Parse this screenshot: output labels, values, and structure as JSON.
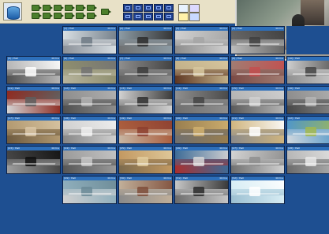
{
  "toolbar": {
    "app_icon": "database-icon",
    "camera_buttons": 6,
    "layout_buttons": 10,
    "utility_icons": [
      "camera-search-icon",
      "tag-icon",
      "folder-icon",
      "info-icon"
    ]
  },
  "preview": {
    "label": "store-camera-preview"
  },
  "colors": {
    "background": "#1e4f91",
    "toolbar": "#e8e1c7",
    "tile_header": "#2d6fba"
  },
  "tiles": [
    {
      "label": "[1] / Hall",
      "time": "00 hrs",
      "c1": "#d9e0e4",
      "c2": "#8a9098",
      "a": "#6e7a85"
    },
    {
      "label": "[2] / Hall",
      "time": "00 hrs",
      "c1": "#8d9ca6",
      "c2": "#6f7172",
      "a": "#2d2d2d"
    },
    {
      "label": "[3] / Hall",
      "time": "00 hrs",
      "c1": "#d2d2d2",
      "c2": "#8b8b8b",
      "a": "#a6a6a6"
    },
    {
      "label": "[4] / Hall",
      "time": "00 hrs",
      "c1": "#646464",
      "c2": "#bdbdbd",
      "a": "#3f3f3f"
    },
    {
      "label": "[5] / Hall",
      "time": "00 hrs",
      "c1": "#b8b8b8",
      "c2": "#505050",
      "a": "#ffffff"
    },
    {
      "label": "[6] / Hall",
      "time": "00 hrs",
      "c1": "#8e8e6e",
      "c2": "#b7b49d",
      "a": "#727272"
    },
    {
      "label": "[7] / Hall",
      "time": "00 hrs",
      "c1": "#8f8f8f",
      "c2": "#626262",
      "a": "#3c3c3c"
    },
    {
      "label": "[8] / Hall",
      "time": "00 hrs",
      "c1": "#c6b58d",
      "c2": "#5e3622",
      "a": "#d7c79f"
    },
    {
      "label": "[9] / Hall",
      "time": "00 hrs",
      "c1": "#a27d73",
      "c2": "#7a4a45",
      "a": "#c44f4f"
    },
    {
      "label": "[10] / Hall",
      "time": "00 hrs",
      "c1": "#cfcfcf",
      "c2": "#8f8f8f",
      "a": "#444444"
    },
    {
      "label": "[11] / Hall",
      "time": "00 hrs",
      "c1": "#8e2a20",
      "c2": "#d4d4d4",
      "a": "#5e5e5e"
    },
    {
      "label": "[12] / Hall",
      "time": "00 hrs",
      "c1": "#8f8f8f",
      "c2": "#4f4f4f",
      "a": "#b3b3b3"
    },
    {
      "label": "[13] / Hall",
      "time": "00 hrs",
      "c1": "#d3d3d3",
      "c2": "#6f6f6f",
      "a": "#2f2f2f"
    },
    {
      "label": "[14] / Hall",
      "time": "00 hrs",
      "c1": "#909090",
      "c2": "#6e6e6e",
      "a": "#444444"
    },
    {
      "label": "[15] / Hall",
      "time": "00 hrs",
      "c1": "#b7b7b7",
      "c2": "#5a5a5a",
      "a": "#d0d0d0"
    },
    {
      "label": "[16] / Hall",
      "time": "00 hrs",
      "c1": "#8f8f8f",
      "c2": "#474747",
      "a": "#b5b5b5"
    },
    {
      "label": "[17] / Hall",
      "time": "00 hrs",
      "c1": "#b49b72",
      "c2": "#6d5a3f",
      "a": "#d9c6a4"
    },
    {
      "label": "[18] / Hall",
      "time": "00 hrs",
      "c1": "#d2d2d2",
      "c2": "#868686",
      "a": "#f0f0f0"
    },
    {
      "label": "[19] / Hall",
      "time": "00 hrs",
      "c1": "#aa5c3c",
      "c2": "#c7b6a3",
      "a": "#8d3f2f"
    },
    {
      "label": "[20] / Hall",
      "time": "00 hrs",
      "c1": "#9a7f4f",
      "c2": "#6f6f6f",
      "a": "#d0b06f"
    },
    {
      "label": "[21] / Hall",
      "time": "00 hrs",
      "c1": "#d1b67f",
      "c2": "#8a8a8a",
      "a": "#ffffff"
    },
    {
      "label": "[22] / Hall",
      "time": "00 hrs",
      "c1": "#4f96c8",
      "c2": "#d0d7dd",
      "a": "#a2b94d"
    },
    {
      "label": "[23] / Hall",
      "time": "00 hrs",
      "c1": "#444444",
      "c2": "#9f9f9f",
      "a": "#111111"
    },
    {
      "label": "[24] / Hall",
      "time": "00 hrs",
      "c1": "#9c9c9c",
      "c2": "#555555",
      "a": "#c7c7c7"
    },
    {
      "label": "[25] / Hall",
      "time": "00 hrs",
      "c1": "#c49a62",
      "c2": "#7b6a4d",
      "a": "#e2cc9e"
    },
    {
      "label": "[26] / Hall",
      "time": "00 hrs",
      "c1": "#3c6d99",
      "c2": "#a92f2f",
      "a": "#d7d7d7"
    },
    {
      "label": "[27] / Hall",
      "time": "00 hrs",
      "c1": "#d4d4d4",
      "c2": "#6f6f6f",
      "a": "#8f8f8f"
    },
    {
      "label": "[28] / Hall",
      "time": "00 hrs",
      "c1": "#b8b8b8",
      "c2": "#6a6a6a",
      "a": "#e8e8e8"
    },
    {
      "label": "[29] / Hall",
      "time": "00 hrs",
      "c1": "#8eaebc",
      "c2": "#d0d0d0",
      "a": "#6b8a96"
    },
    {
      "label": "[30] / Hall",
      "time": "00 hrs",
      "c1": "#c2b09a",
      "c2": "#8a8a8a",
      "a": "#7f4e3a"
    },
    {
      "label": "[31] / Hall",
      "time": "00 hrs",
      "c1": "#c9c9c9",
      "c2": "#6b6b6b",
      "a": "#2c2c2c"
    },
    {
      "label": "[32] / Hall",
      "time": "00 hrs",
      "c1": "#d9eef5",
      "c2": "#9bbfd1",
      "a": "#ffffff"
    }
  ]
}
